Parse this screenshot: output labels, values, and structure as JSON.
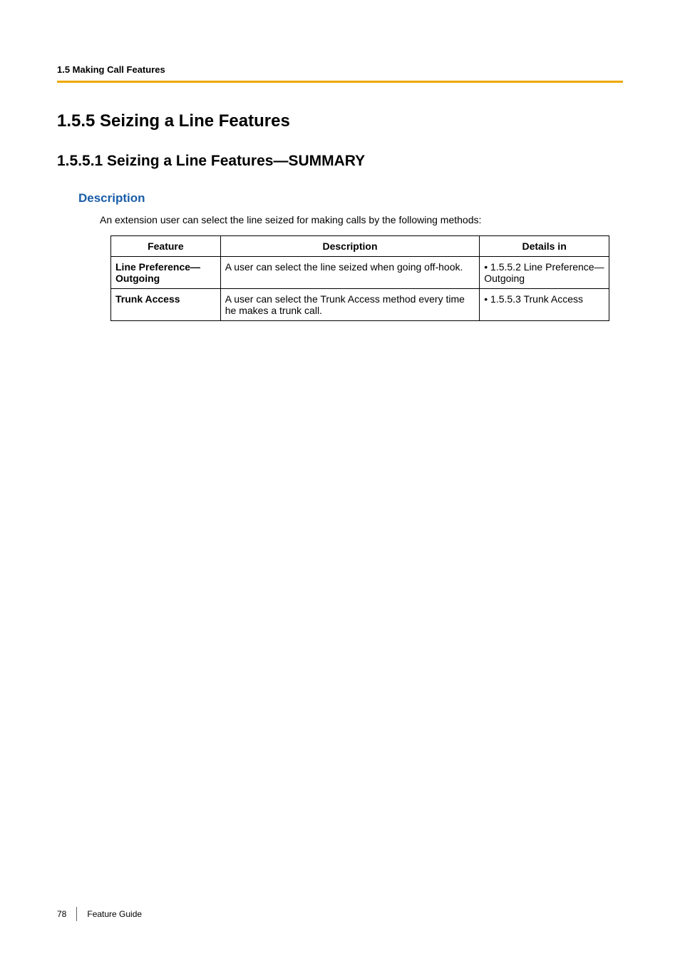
{
  "header": {
    "breadcrumb": "1.5 Making Call Features"
  },
  "main": {
    "heading1": "1.5.5    Seizing a Line Features",
    "heading2": "1.5.5.1    Seizing a Line Features—SUMMARY",
    "section_label": "Description",
    "intro": "An extension user can select the line seized for making calls by the following methods:"
  },
  "table": {
    "headers": {
      "feature": "Feature",
      "description": "Description",
      "details": "Details in"
    },
    "rows": [
      {
        "feature": "Line Preference—Outgoing",
        "description": "A user can select the line seized when going off-hook.",
        "details": "• 1.5.5.2 Line Preference—Outgoing"
      },
      {
        "feature": "Trunk Access",
        "description": "A user can select the Trunk Access method every time he makes a trunk call.",
        "details": "• 1.5.5.3 Trunk Access"
      }
    ]
  },
  "footer": {
    "page": "78",
    "title": "Feature Guide"
  }
}
